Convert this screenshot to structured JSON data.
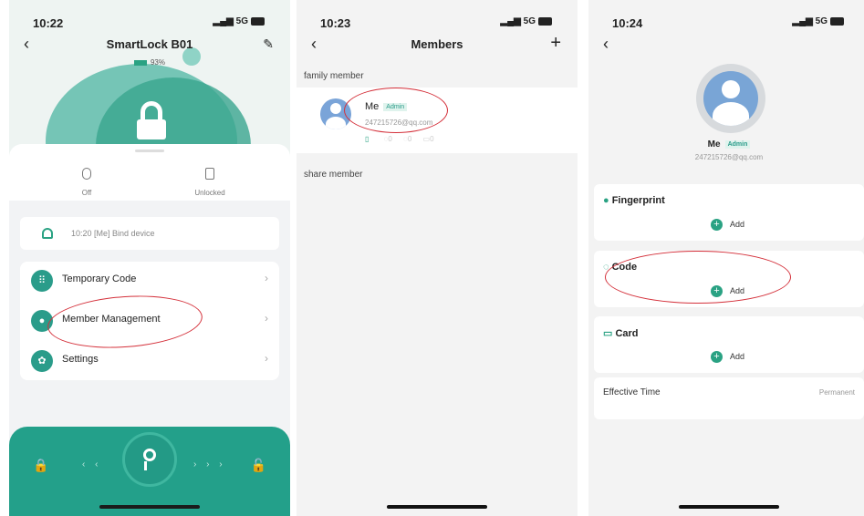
{
  "screens": {
    "one": {
      "time": "10:22",
      "signal": "5G",
      "title": "SmartLock B01",
      "battery_pct": "93%",
      "state_left": "Off",
      "state_right": "Unlocked",
      "notice": "10:20 [Me] Bind device",
      "menu": [
        {
          "label": "Temporary Code",
          "icon": "grid-icon"
        },
        {
          "label": "Member Management",
          "icon": "person-icon"
        },
        {
          "label": "Settings",
          "icon": "gear-icon"
        }
      ]
    },
    "two": {
      "time": "10:23",
      "signal": "5G",
      "title": "Members",
      "family_header": "family member",
      "member_name": "Me",
      "member_badge": "Admin",
      "member_email": "247215726@qq.com",
      "counts": [
        "0",
        "0",
        "0"
      ],
      "share_header": "share member"
    },
    "three": {
      "time": "10:24",
      "signal": "5G",
      "name": "Me",
      "badge": "Admin",
      "email": "247215726@qq.com",
      "fingerprint": "Fingerprint",
      "code": "Code",
      "card": "Card",
      "add": "Add",
      "effective_time": "Effective Time",
      "effective_value": "Permanent"
    }
  },
  "colors": {
    "accent": "#2aa283",
    "annotation": "#d4303a"
  }
}
